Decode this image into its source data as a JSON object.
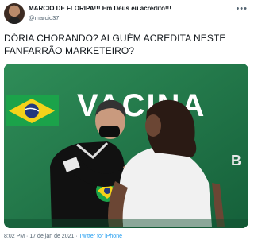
{
  "tweet": {
    "author_name": "MARCIO DE FLORIPA!!! Em Deus eu acredito!!!",
    "handle": "@marcio37",
    "more_label": "•••",
    "text": "DÓRIA CHORANDO? ALGUÉM ACREDITA NESTE FANFARRÃO MARKETEIRO?",
    "time": "8:02 PM",
    "separator": "·",
    "date": "17 de jan de 2021",
    "client": "Twitter for iPhone"
  },
  "media": {
    "banner_text": "VACINA",
    "banner_partial": "B",
    "colors": {
      "background": "#1f7a48",
      "banner": "#ffffff",
      "link": "#1d9bf0"
    }
  }
}
